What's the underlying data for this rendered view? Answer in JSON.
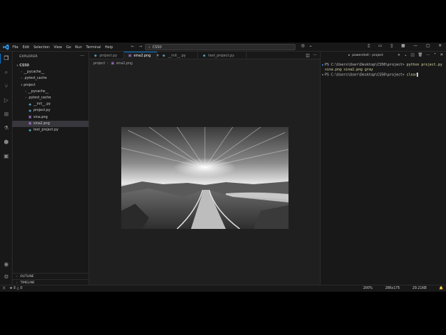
{
  "titlebar": {
    "menu": [
      "File",
      "Edit",
      "Selection",
      "View",
      "Go",
      "Run",
      "Terminal",
      "Help"
    ],
    "search_text": "CS50",
    "nav_back": "←",
    "nav_forward": "→"
  },
  "sidebar": {
    "title": "EXPLORER",
    "more": "···",
    "tree": [
      {
        "label": "CS50",
        "chevron": "∨",
        "indent": 0,
        "icon": "",
        "bold": true
      },
      {
        "label": "__pycache__",
        "chevron": "›",
        "indent": 1,
        "icon": ""
      },
      {
        "label": ".pytest_cache",
        "chevron": "›",
        "indent": 1,
        "icon": ""
      },
      {
        "label": "project",
        "chevron": "∨",
        "indent": 1,
        "icon": ""
      },
      {
        "label": "__pycache__",
        "chevron": "›",
        "indent": 2,
        "icon": ""
      },
      {
        "label": ".pytest_cache",
        "chevron": "›",
        "indent": 2,
        "icon": ""
      },
      {
        "label": "__init__.py",
        "chevron": "",
        "indent": 2,
        "icon": "py"
      },
      {
        "label": "project.py",
        "chevron": "",
        "indent": 2,
        "icon": "py"
      },
      {
        "label": "sina.png",
        "chevron": "",
        "indent": 2,
        "icon": "png"
      },
      {
        "label": "sina2.png",
        "chevron": "",
        "indent": 2,
        "icon": "png",
        "selected": true
      },
      {
        "label": "test_project.py",
        "chevron": "",
        "indent": 2,
        "icon": "py"
      }
    ],
    "outline": "OUTLINE",
    "timeline": "TIMELINE"
  },
  "editor": {
    "tabs": [
      {
        "label": "project.py",
        "icon": "py",
        "active": false
      },
      {
        "label": "sina2.png",
        "icon": "png",
        "active": true,
        "close": "✕"
      },
      {
        "label": "__init__.py",
        "icon": "py",
        "active": false
      },
      {
        "label": "test_project.py",
        "icon": "py",
        "active": false
      }
    ],
    "breadcrumb": [
      "project",
      "sina2.png"
    ]
  },
  "terminal": {
    "tab_name": "powershell - project",
    "lines": [
      {
        "prompt": "PS C:\\Users\\User\\Desktop\\CS50\\project> ",
        "command": "python project.py sina.png sina2.png gray",
        "dot": "blue"
      },
      {
        "prompt": "PS C:\\Users\\User\\Desktop\\CS50\\project> ",
        "command": "clear",
        "dot": "grey"
      }
    ]
  },
  "statusbar": {
    "errors": "0",
    "warnings": "0",
    "zoom": "200%",
    "dimensions": "286x175",
    "filesize": "29.21KB"
  },
  "colors": {
    "accent": "#0078d4",
    "sidebar_bg": "#181818",
    "editor_bg": "#1f1f1f"
  }
}
